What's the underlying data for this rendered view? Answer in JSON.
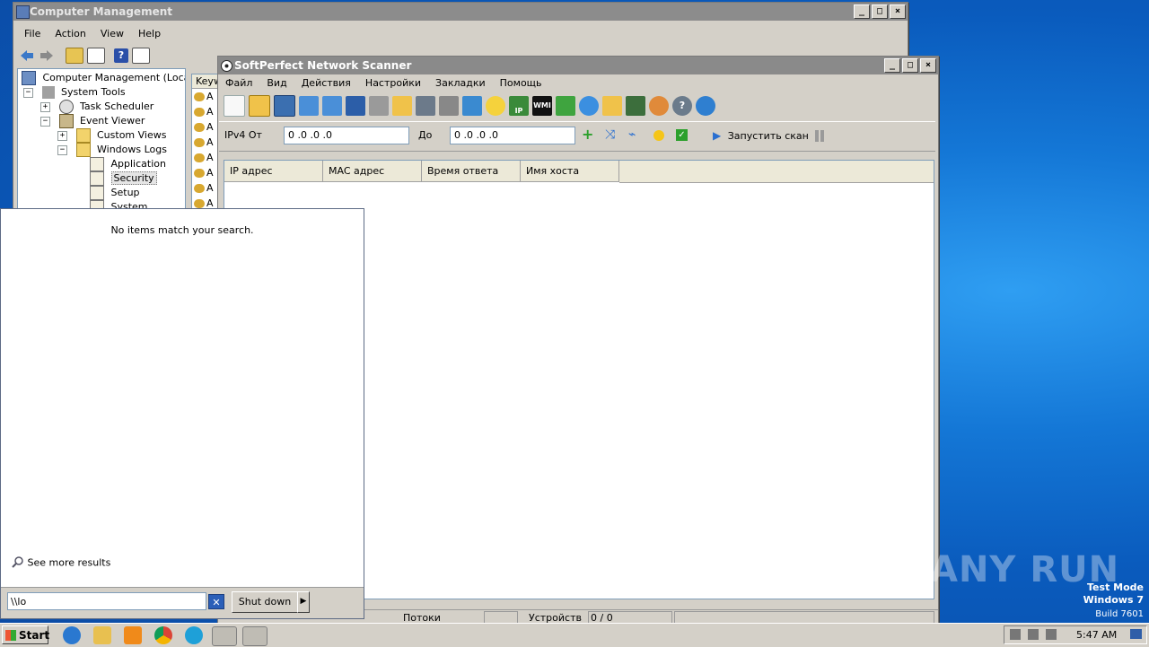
{
  "computer_management": {
    "title": "Computer Management",
    "menu": [
      "File",
      "Action",
      "View",
      "Help"
    ],
    "tree": {
      "root": "Computer Management (Local)",
      "system_tools": "System Tools",
      "task_scheduler": "Task Scheduler",
      "event_viewer": "Event Viewer",
      "custom_views": "Custom Views",
      "windows_logs": "Windows Logs",
      "application": "Application",
      "security": "Security",
      "setup": "Setup",
      "system": "System"
    },
    "list_header": "Keyw",
    "list_rows": [
      "A",
      "A",
      "A",
      "A",
      "A",
      "A",
      "A",
      "A"
    ]
  },
  "scanner": {
    "title": "SoftPerfect Network Scanner",
    "menu": [
      "Файл",
      "Вид",
      "Действия",
      "Настройки",
      "Закладки",
      "Помощь"
    ],
    "ipv4_from_label": "IPv4 От",
    "ip_from": "0  .0  .0  .0",
    "to_label": "До",
    "ip_to": "0  .0  .0  .0",
    "scan_button": "Запустить скан",
    "wmi_label": "WMI",
    "ip_badge": "IP",
    "columns": [
      "IP адрес",
      "MAC адрес",
      "Время ответа",
      "Имя хоста"
    ],
    "status": {
      "left_label": "Потоки",
      "left_value": "",
      "devices_label": "Устройств",
      "devices_value": "0 / 0"
    }
  },
  "start_menu": {
    "no_results": "No items match your search.",
    "see_more": "See more results",
    "search_value": "\\\\lo",
    "shutdown": "Shut down"
  },
  "watermark": {
    "brand": "ANY RUN",
    "test_mode": "Test Mode",
    "os": "Windows 7",
    "build": "Build 7601"
  },
  "taskbar": {
    "start": "Start",
    "clock": "5:47 AM"
  },
  "colors": {
    "desktop": "#1477d6",
    "window_face": "#d4d0c8",
    "title_inactive": "#8c8c8c"
  }
}
